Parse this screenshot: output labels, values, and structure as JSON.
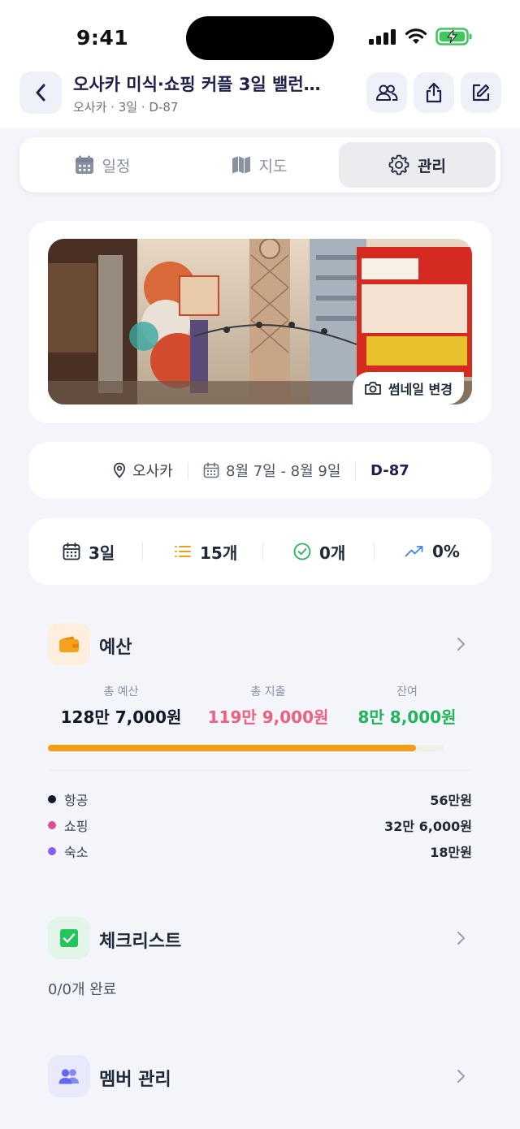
{
  "status_bar": {
    "time": "9:41"
  },
  "header": {
    "title": "오사카 미식·쇼핑 커플 3일 밸런…",
    "subtitle": "오사카 · 3일 · D-87"
  },
  "tabs": [
    {
      "label": "일정",
      "icon": "calendar-icon",
      "active": false
    },
    {
      "label": "지도",
      "icon": "map-icon",
      "active": false
    },
    {
      "label": "관리",
      "icon": "gear-icon",
      "active": true
    }
  ],
  "thumbnail": {
    "change_label": "썸네일 변경"
  },
  "trip_info": {
    "location": "오사카",
    "dates": "8월 7일 - 8월 9일",
    "dday": "D-87"
  },
  "stats": [
    {
      "value": "3일",
      "icon": "calendar-icon"
    },
    {
      "value": "15개",
      "icon": "list-icon"
    },
    {
      "value": "0개",
      "icon": "check-circle-icon"
    },
    {
      "value": "0%",
      "icon": "trending-up-icon"
    }
  ],
  "budget": {
    "title": "예산",
    "total_label": "총 예산",
    "total_value": "128만 7,000원",
    "spent_label": "총 지출",
    "spent_value": "119만 9,000원",
    "remain_label": "잔여",
    "remain_value": "8만 8,000원",
    "progress_fraction": 0.93,
    "breakdown": [
      {
        "name": "항공",
        "amount": "56만원",
        "color": "#111633"
      },
      {
        "name": "쇼핑",
        "amount": "32만 6,000원",
        "color": "#e04a9a"
      },
      {
        "name": "숙소",
        "amount": "18만원",
        "color": "#8b5cf6"
      }
    ]
  },
  "checklist": {
    "title": "체크리스트",
    "summary": "0/0개 완료"
  },
  "members": {
    "title": "멤버 관리"
  },
  "colors": {
    "accent_orange": "#f29f16",
    "spent_pink": "#ef5f7e",
    "remain_green": "#22b45a",
    "navy": "#1e1f4b"
  }
}
